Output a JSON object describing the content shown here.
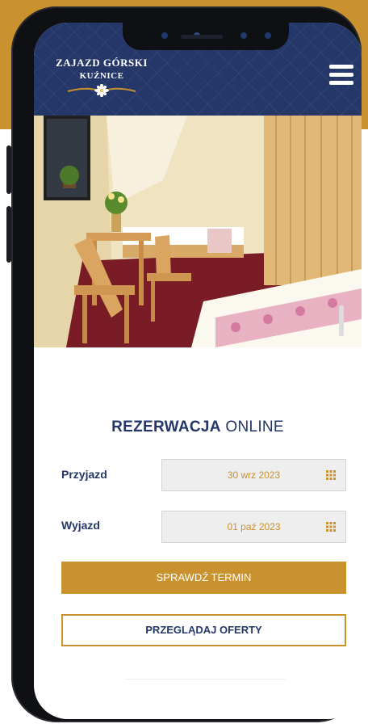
{
  "header": {
    "logo_line1": "ZAJAZD GÓRSKI",
    "logo_line2": "KUŹNICE",
    "logo_icon": "edelweiss-icon",
    "menu_icon": "hamburger-menu-icon",
    "bg_color": "#243768"
  },
  "hero": {
    "icon": "hotel-room-photo"
  },
  "booking": {
    "title_bold": "REZERWACJA",
    "title_rest": "ONLINE",
    "arrival_label": "Przyjazd",
    "arrival_value": "30 wrz 2023",
    "departure_label": "Wyjazd",
    "departure_value": "01 paź 2023",
    "calendar_icon": "calendar-grid-icon",
    "check_button": "SPRAWDŹ TERMIN",
    "offers_button": "PRZEGLĄDAJ OFERTY"
  },
  "colors": {
    "accent": "#c9922e",
    "navy": "#243768"
  }
}
